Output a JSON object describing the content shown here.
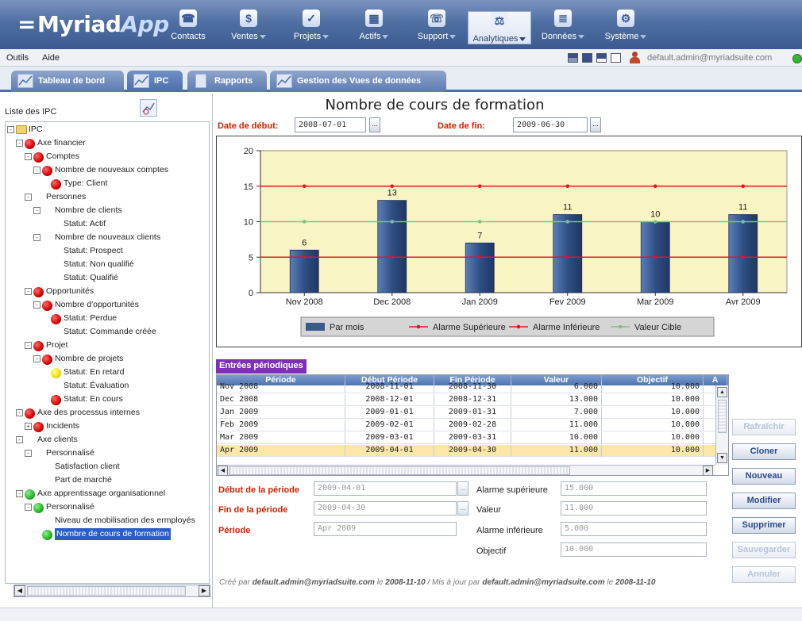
{
  "app": {
    "logo_main": "Myriad",
    "logo_accent": "App"
  },
  "nav": [
    {
      "label": "Contacts",
      "icon": "phone-icon",
      "glyph": "☎"
    },
    {
      "label": "Ventes",
      "icon": "sales-icon",
      "glyph": "$"
    },
    {
      "label": "Projets",
      "icon": "projects-icon",
      "glyph": "✓"
    },
    {
      "label": "Actifs",
      "icon": "assets-icon",
      "glyph": "▦"
    },
    {
      "label": "Support",
      "icon": "support-icon",
      "glyph": "☏"
    },
    {
      "label": "Analytiques",
      "icon": "analytics-icon",
      "glyph": "⚖"
    },
    {
      "label": "Données",
      "icon": "database-icon",
      "glyph": "≣"
    },
    {
      "label": "Système",
      "icon": "system-icon",
      "glyph": "⚙"
    }
  ],
  "menu": {
    "tools": "Outils",
    "help": "Aide",
    "user_email": "default.admin@myriadsuite.com"
  },
  "tabs": [
    {
      "label": "Tableau de bord"
    },
    {
      "label": "IPC"
    },
    {
      "label": "Rapports"
    },
    {
      "label": "Gestion des Vues de données"
    }
  ],
  "left_panel": {
    "title": "Liste des IPC"
  },
  "tree": [
    {
      "label": "IPC"
    },
    {
      "label": "Axe financier"
    },
    {
      "label": "Comptes"
    },
    {
      "label": "Nombre de nouveaux comptes"
    },
    {
      "label": "Type: Client"
    },
    {
      "label": "Personnes"
    },
    {
      "label": "Nombre de clients"
    },
    {
      "label": "Statut: Actif"
    },
    {
      "label": "Nombre de nouveaux clients"
    },
    {
      "label": "Statut: Prospect"
    },
    {
      "label": "Statut: Non qualifié"
    },
    {
      "label": "Statut: Qualifié"
    },
    {
      "label": "Opportunités"
    },
    {
      "label": "Nombre d'opportunités"
    },
    {
      "label": "Statut: Perdue"
    },
    {
      "label": "Statut: Commande créée"
    },
    {
      "label": "Projet"
    },
    {
      "label": "Nombre de projets"
    },
    {
      "label": "Statut: En retard"
    },
    {
      "label": "Statut: Évaluation"
    },
    {
      "label": "Statut: En cours"
    },
    {
      "label": "Axe des processus internes"
    },
    {
      "label": "Incidents"
    },
    {
      "label": "Axe clients"
    },
    {
      "label": "Personnalisé"
    },
    {
      "label": "Satisfaction client"
    },
    {
      "label": "Part de marché"
    },
    {
      "label": "Axe apprentissage organisationnel"
    },
    {
      "label": "Personnalisé"
    },
    {
      "label": "Niveau de mobilisation des ermployés"
    },
    {
      "label": "Nombre de cours de formation"
    }
  ],
  "main": {
    "title": "Nombre de cours de formation",
    "start_label": "Date de début:",
    "start_value": "2008-07-01",
    "end_label": "Date de fin:",
    "end_value": "2009-06-30",
    "picker_glyph": "..."
  },
  "chart_data": {
    "type": "bar",
    "categories": [
      "Nov 2008",
      "Dec 2008",
      "Jan 2009",
      "Fev 2009",
      "Mar 2009",
      "Avr 2009"
    ],
    "series": [
      {
        "name": "Par mois",
        "kind": "bar",
        "values": [
          6,
          13,
          7,
          11,
          10,
          11
        ],
        "color": "#3a5a8c"
      },
      {
        "name": "Alarme Supérieure",
        "kind": "line",
        "values": [
          15,
          15,
          15,
          15,
          15,
          15
        ],
        "color": "#d61c1c"
      },
      {
        "name": "Alarme Inférieure",
        "kind": "line",
        "values": [
          5,
          5,
          5,
          5,
          5,
          5
        ],
        "color": "#d61c1c"
      },
      {
        "name": "Valeur Cible",
        "kind": "line",
        "values": [
          10,
          10,
          10,
          10,
          10,
          10
        ],
        "color": "#7fc27f"
      }
    ],
    "y_ticks": [
      0,
      5,
      10,
      15,
      20
    ],
    "ylim": [
      0,
      20
    ],
    "plot_background": "#f9f4c4",
    "legend_position": "bottom"
  },
  "periodic": {
    "title": "Entrées périodiques",
    "headers": [
      "Période",
      "Début Période",
      "Fin Période",
      "Valeur",
      "Objectif",
      "A"
    ],
    "rows": [
      [
        "Nov 2008",
        "2008-11-01",
        "2008-11-30",
        "6.000",
        "10.000"
      ],
      [
        "Dec 2008",
        "2008-12-01",
        "2008-12-31",
        "13.000",
        "10.000"
      ],
      [
        "Jan 2009",
        "2009-01-01",
        "2009-01-31",
        "7.000",
        "10.000"
      ],
      [
        "Feb 2009",
        "2009-02-01",
        "2009-02-28",
        "11.000",
        "10.000"
      ],
      [
        "Mar 2009",
        "2009-03-01",
        "2009-03-31",
        "10.000",
        "10.000"
      ],
      [
        "Apr 2009",
        "2009-04-01",
        "2009-04-30",
        "11.000",
        "10.000"
      ]
    ]
  },
  "form": {
    "start_label": "Début de la période",
    "start_value": "2009-04-01",
    "end_label": "Fin de la période",
    "end_value": "2009-04-30",
    "period_label": "Période",
    "period_value": "Apr 2009",
    "upper_label": "Alarme supérieure",
    "upper_value": "15.000",
    "value_label": "Valeur",
    "value_value": "11.000",
    "lower_label": "Alarme inférieure",
    "lower_value": "5.000",
    "target_label": "Objectif",
    "target_value": "10.000"
  },
  "buttons": {
    "refresh": "Rafraîchir",
    "clone": "Cloner",
    "new": "Nouveau",
    "edit": "Modifier",
    "delete": "Supprimer",
    "save": "Sauvegarder",
    "cancel": "Annuler"
  },
  "footer": {
    "created_by": "Créé par",
    "creator": "default.admin@myriadsuite.com",
    "on1": "le",
    "created_date": "2008-11-10",
    "updated_by": "/ Mis à jour par",
    "updater": "default.admin@myriadsuite.com",
    "on2": "le",
    "updated_date": "2008-11-10"
  }
}
